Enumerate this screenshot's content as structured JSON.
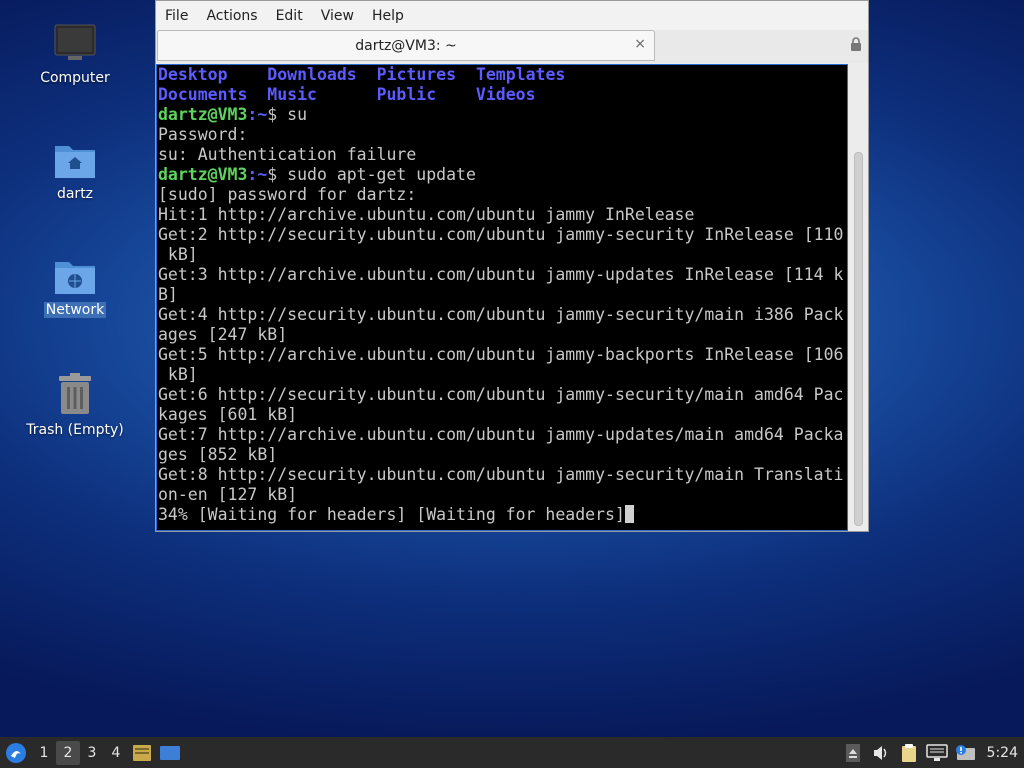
{
  "desktop": {
    "icons": [
      {
        "label": "Computer",
        "icon": "computer-icon"
      },
      {
        "label": "dartz",
        "icon": "home-folder-icon"
      },
      {
        "label": "Network",
        "icon": "network-folder-icon"
      },
      {
        "label": "Trash (Empty)",
        "icon": "trash-icon"
      }
    ]
  },
  "window": {
    "menu": [
      "File",
      "Actions",
      "Edit",
      "View",
      "Help"
    ],
    "tab_title": "dartz@VM3: ~",
    "tab_close": "×"
  },
  "terminal": {
    "dirs_row1": [
      "Desktop",
      "Downloads",
      "Pictures",
      "Templates"
    ],
    "dirs_row2": [
      "Documents",
      "Music",
      "Public",
      "Videos"
    ],
    "prompt_user": "dartz@VM3",
    "prompt_path": ":~",
    "cmd1": "$ su",
    "out1": "Password:\nsu: Authentication failure",
    "cmd2": "$ sudo apt-get update",
    "out2": "[sudo] password for dartz:\nHit:1 http://archive.ubuntu.com/ubuntu jammy InRelease\nGet:2 http://security.ubuntu.com/ubuntu jammy-security InRelease [110\n kB]\nGet:3 http://archive.ubuntu.com/ubuntu jammy-updates InRelease [114 k\nB]\nGet:4 http://security.ubuntu.com/ubuntu jammy-security/main i386 Pack\nages [247 kB]\nGet:5 http://archive.ubuntu.com/ubuntu jammy-backports InRelease [106\n kB]\nGet:6 http://security.ubuntu.com/ubuntu jammy-security/main amd64 Pac\nkages [601 kB]\nGet:7 http://archive.ubuntu.com/ubuntu jammy-updates/main amd64 Packa\nges [852 kB]\nGet:8 http://security.ubuntu.com/ubuntu jammy-security/main Translati\non-en [127 kB]\n",
    "progress_line": "34% [Waiting for headers] [Waiting for headers]"
  },
  "taskbar": {
    "workspaces": [
      "1",
      "2",
      "3",
      "4"
    ],
    "active_workspace": "2",
    "clock": "5:24"
  }
}
